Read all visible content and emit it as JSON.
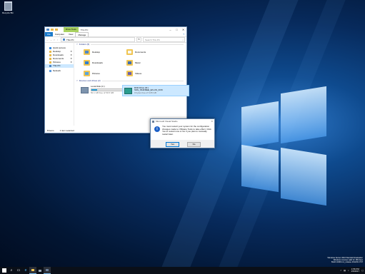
{
  "desktop": {
    "recycle_bin_label": "Recycle Bin",
    "watermark": {
      "line1": "Windows Server 2016 Standard Evaluation",
      "line2": "Windows License valid for 180 days",
      "line3": "Build 14393.rs1_release.161220-1747"
    }
  },
  "explorer": {
    "drive_tools_label": "Drive Tools",
    "window_title": "This PC",
    "ribbon_tabs": [
      "File",
      "Computer",
      "View",
      "Manage"
    ],
    "help_glyph": "?",
    "address_path": "This PC",
    "search_placeholder": "Search This PC",
    "nav": {
      "quick_access": "Quick access",
      "desktop": "Desktop",
      "downloads": "Downloads",
      "documents": "Documents",
      "pictures": "Pictures",
      "this_pc": "This PC",
      "network": "Network"
    },
    "folders_heading": "Folders (6)",
    "folders": {
      "desktop": "Desktop",
      "documents": "Documents",
      "downloads": "Downloads",
      "music": "Music",
      "pictures": "Pictures",
      "videos": "Videos"
    },
    "devices_heading": "Devices and drives (2)",
    "local_disk": {
      "name": "Local Disk (C:)",
      "free": "50.1 GB free of 59.5 GB",
      "used_fraction": 0.16
    },
    "dvd_drive": {
      "name": "DVD Drive (D:)",
      "label": "SSS_X64FREE_EN-US_DV9",
      "free": "0 bytes free of 6.05 GB"
    },
    "status": {
      "items": "8 items",
      "selected": "1 item selected"
    }
  },
  "dialog": {
    "title": "Microsoft Visual Studio",
    "close_glyph": "✕",
    "icon_glyph": "i",
    "message": "You must restart your system for the configuration changes made to VMware Tools to take effect. Click Yes to restart now or No if you plan to manually restart later.",
    "yes_label": "Yes",
    "no_label": "No"
  },
  "taskbar": {
    "time": "1:56 PM",
    "date": "1/5/2017"
  },
  "colors": {
    "accent": "#0078d7",
    "drive_tools": "#a9d25f",
    "selection": "#cce8ff"
  }
}
